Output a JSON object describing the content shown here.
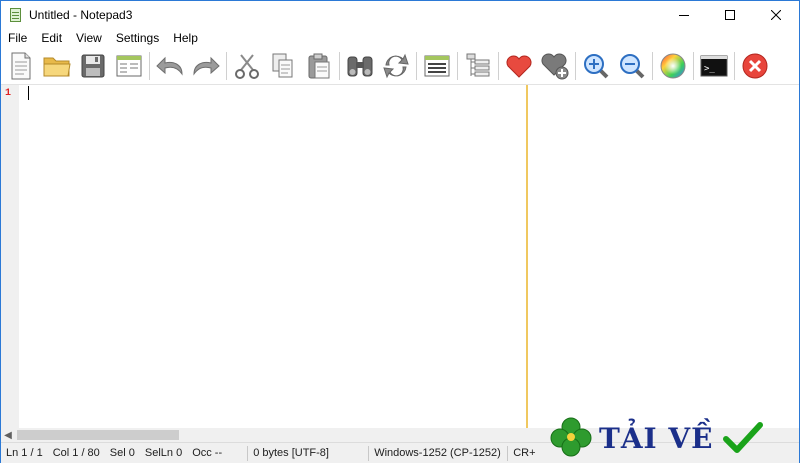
{
  "window": {
    "title": "Untitled - Notepad3"
  },
  "menu": [
    "File",
    "Edit",
    "View",
    "Settings",
    "Help"
  ],
  "toolbar": [
    {
      "name": "new-file-icon"
    },
    {
      "name": "open-folder-icon"
    },
    {
      "name": "save-icon"
    },
    {
      "name": "browse-icon"
    },
    {
      "sep": true
    },
    {
      "name": "undo-icon"
    },
    {
      "name": "redo-icon"
    },
    {
      "sep": true
    },
    {
      "name": "cut-icon"
    },
    {
      "name": "copy-icon"
    },
    {
      "name": "paste-icon"
    },
    {
      "sep": true
    },
    {
      "name": "find-icon"
    },
    {
      "name": "replace-icon"
    },
    {
      "sep": true
    },
    {
      "name": "word-wrap-icon"
    },
    {
      "sep": true
    },
    {
      "name": "tree-view-icon"
    },
    {
      "sep": true
    },
    {
      "name": "favorites-icon"
    },
    {
      "name": "add-favorite-icon"
    },
    {
      "sep": true
    },
    {
      "name": "zoom-in-icon"
    },
    {
      "name": "zoom-out-icon"
    },
    {
      "sep": true
    },
    {
      "name": "color-scheme-icon"
    },
    {
      "sep": true
    },
    {
      "name": "command-prompt-icon"
    },
    {
      "sep": true
    },
    {
      "name": "exit-icon"
    }
  ],
  "editor": {
    "line_number": "1",
    "long_line_marker_color": "#f0c860"
  },
  "status": {
    "line": "Ln 1 / 1",
    "col": "Col 1 / 80",
    "sel": "Sel 0",
    "selln": "SelLn 0",
    "occ": "Occ --",
    "size": "0 bytes [UTF-8]",
    "encoding": "Windows-1252 (CP-1252)",
    "eol": "CR+"
  },
  "watermark": {
    "text": "TẢI VỀ",
    "clover_color": "#2e9b2e",
    "check_color": "#1aa31a"
  }
}
